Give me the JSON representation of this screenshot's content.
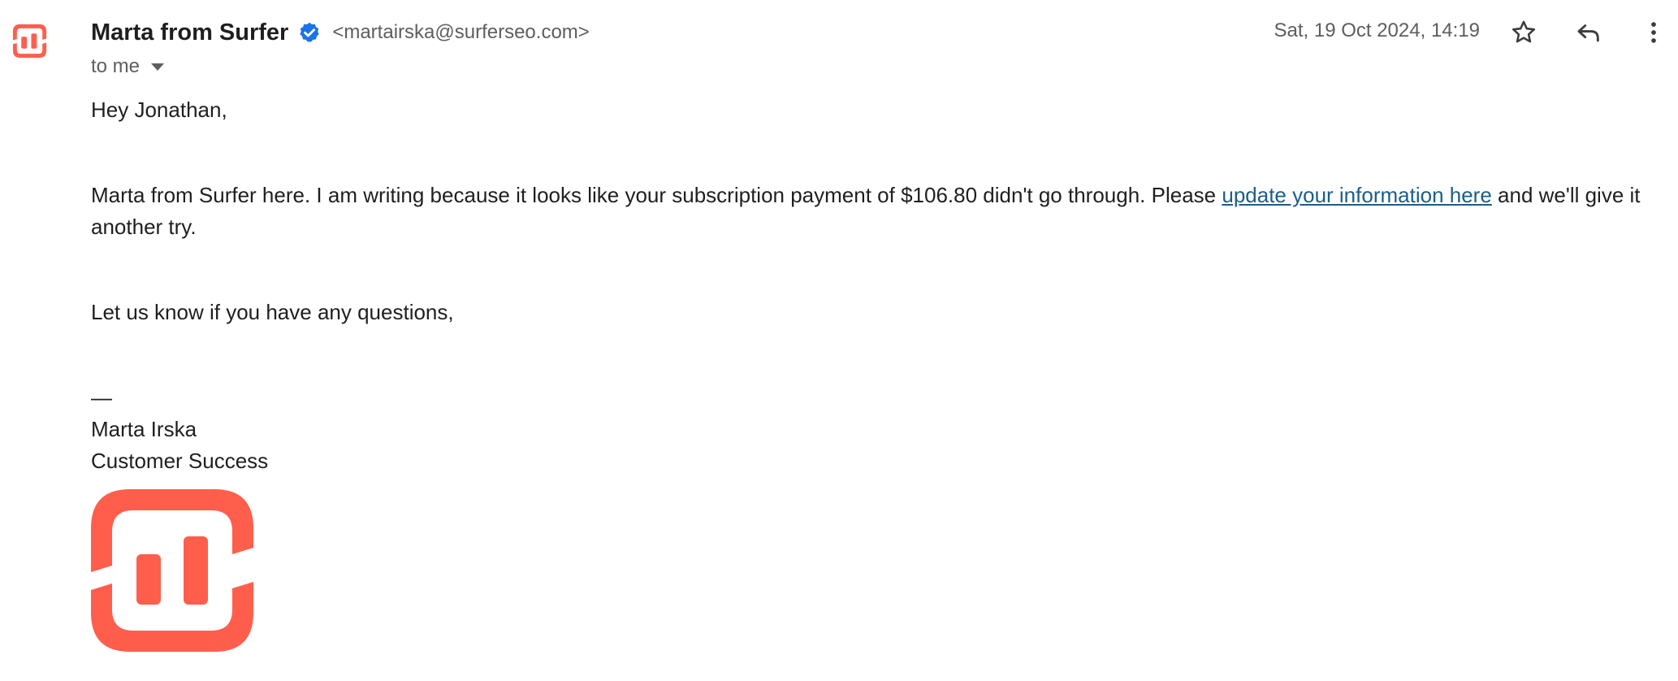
{
  "sender": {
    "name": "Marta from Surfer",
    "email": "<martairska@surferseo.com>",
    "verified_icon": "verified-badge-icon",
    "avatar_icon": "surfer-logo-icon"
  },
  "recipient": {
    "label": "to me"
  },
  "date": "Sat, 19 Oct 2024, 14:19",
  "actions": {
    "star_icon": "star-icon",
    "reply_icon": "reply-icon",
    "more_icon": "more-vertical-icon"
  },
  "body": {
    "greeting": "Hey Jonathan,",
    "para1_before": "Marta from Surfer here. I am writing because it looks like your subscription payment of $106.80 didn't go through. Please ",
    "para1_link": "update your information here",
    "para1_after": " and we'll give it another try.",
    "para2": "Let us know if you have any questions,",
    "sig_dash": "—",
    "sig_name": "Marta Irska",
    "sig_title": "Customer Success"
  },
  "colors": {
    "brand": "#ff5e4d",
    "verified": "#1a73e8",
    "link": "#1a5e8a"
  }
}
